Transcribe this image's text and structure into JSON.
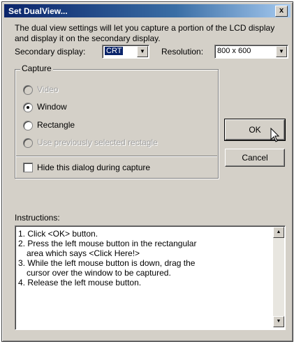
{
  "window": {
    "title": "Set DualView...",
    "close_label": "x"
  },
  "description": "The dual view settings will let you capture a portion of the LCD display and display it on the secondary display.",
  "secondary_display": {
    "label": "Secondary display:",
    "value": "CRT"
  },
  "resolution": {
    "label": "Resolution:",
    "value": "800 x 600"
  },
  "capture": {
    "legend": "Capture",
    "options": [
      {
        "label": "Video",
        "enabled": false,
        "selected": false
      },
      {
        "label": "Window",
        "enabled": true,
        "selected": true
      },
      {
        "label": "Rectangle",
        "enabled": true,
        "selected": false
      },
      {
        "label": "Use previously selected rectagle",
        "enabled": false,
        "selected": false
      }
    ]
  },
  "hide_dialog": {
    "label": "Hide this dialog during capture",
    "checked": false
  },
  "buttons": {
    "ok": "OK",
    "cancel": "Cancel"
  },
  "instructions": {
    "label": "Instructions:",
    "lines": [
      "1. Click <OK> button.",
      "2. Press the left mouse button in the rectangular",
      "    area which says <Click Here!>",
      "3. While the left mouse button is down, drag the",
      "    cursor over the window to be captured.",
      "4. Release the left mouse button."
    ]
  }
}
